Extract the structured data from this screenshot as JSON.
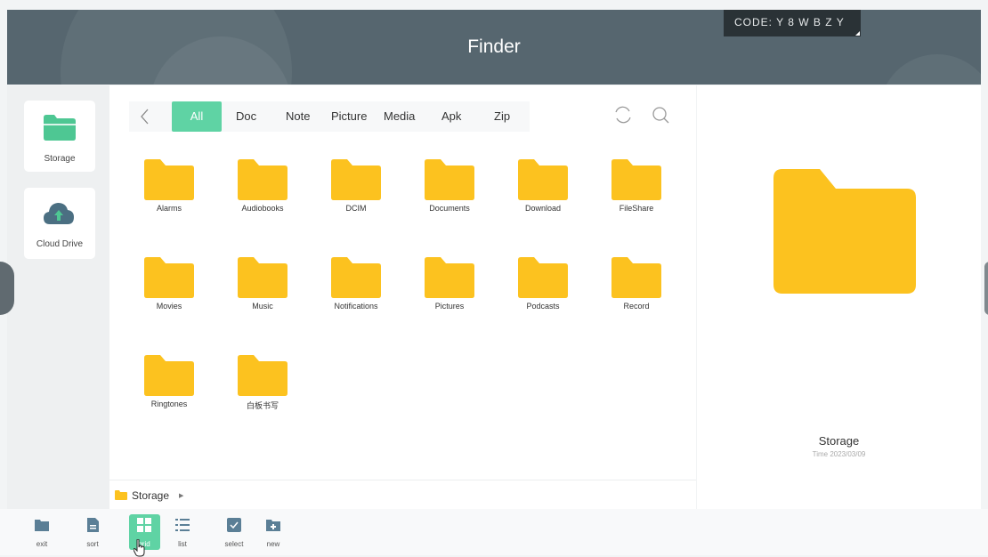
{
  "header": {
    "title": "Finder",
    "code": "CODE: Y 8 W B Z Y"
  },
  "sidebar": {
    "items": [
      {
        "label": "Storage",
        "icon": "folder-icon"
      },
      {
        "label": "Cloud Drive",
        "icon": "cloud-icon"
      }
    ]
  },
  "tabs": [
    {
      "label": "All",
      "active": true
    },
    {
      "label": "Doc"
    },
    {
      "label": "Note"
    },
    {
      "label": "Picture"
    },
    {
      "label": "Media"
    },
    {
      "label": "Apk"
    },
    {
      "label": "Zip"
    }
  ],
  "files": [
    {
      "name": "Alarms"
    },
    {
      "name": "Audiobooks"
    },
    {
      "name": "DCIM"
    },
    {
      "name": "Documents"
    },
    {
      "name": "Download"
    },
    {
      "name": "FileShare"
    },
    {
      "name": "Movies"
    },
    {
      "name": "Music"
    },
    {
      "name": "Notifications"
    },
    {
      "name": "Pictures"
    },
    {
      "name": "Podcasts"
    },
    {
      "name": "Record"
    },
    {
      "name": "Ringtones"
    },
    {
      "name": "白板书写"
    }
  ],
  "path": {
    "label": "Storage"
  },
  "preview": {
    "name": "Storage",
    "time": "Time 2023/03/09"
  },
  "bottombar": {
    "items": [
      {
        "label": "exit"
      },
      {
        "label": "sort"
      },
      {
        "label": "grid",
        "active": true
      },
      {
        "label": "list"
      },
      {
        "label": "select"
      },
      {
        "label": "new"
      }
    ]
  },
  "colors": {
    "accent": "#5fd3a4",
    "folder": "#fcc21f",
    "header": "#56666f",
    "sidebar_folder": "#4ec793",
    "cloud": "#4b6f82"
  }
}
